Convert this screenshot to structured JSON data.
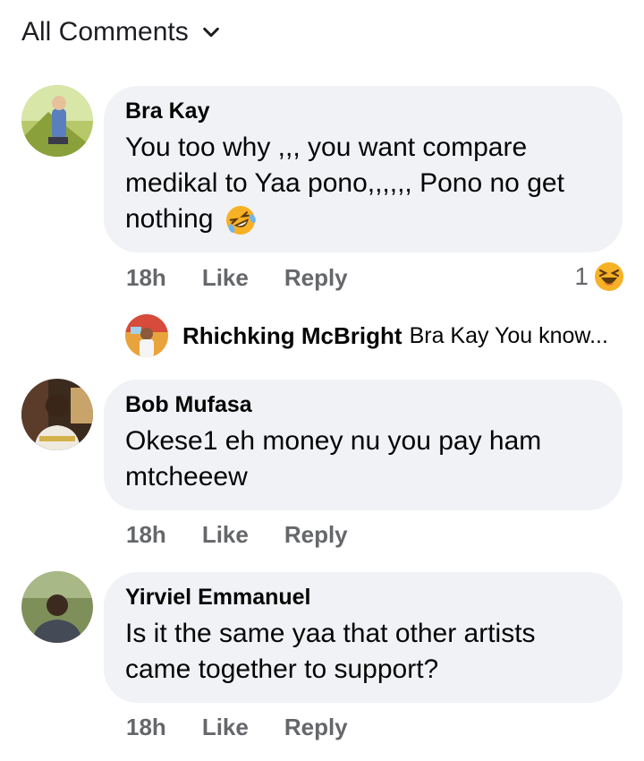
{
  "header": {
    "title": "All Comments",
    "dropdown_icon": "chevron-down-icon"
  },
  "comments": [
    {
      "author": "Bra Kay",
      "line1": "You too why ,,, you want compare",
      "line2": "medikal to Yaa pono,,,,,, Pono no get",
      "line3": "nothing",
      "time": "18h",
      "like": "Like",
      "reply": "Reply",
      "reaction_count": "1"
    },
    {
      "author": "Bob Mufasa",
      "line1": "Okese1 eh money nu you pay ham",
      "line2": "mtcheeew",
      "time": "18h",
      "like": "Like",
      "reply": "Reply"
    },
    {
      "author": "Yirviel Emmanuel",
      "line1": "Is it the same yaa that other artists",
      "line2": "came together to support?",
      "time": "18h",
      "like": "Like",
      "reply": "Reply"
    }
  ],
  "reply_preview": {
    "name": "Rhichking McBright",
    "text": "Bra Kay You know..."
  },
  "colors": {
    "bubble": "#f0f2f5",
    "meta": "#65676b",
    "text": "#050505",
    "emoji": "#f7b125"
  }
}
